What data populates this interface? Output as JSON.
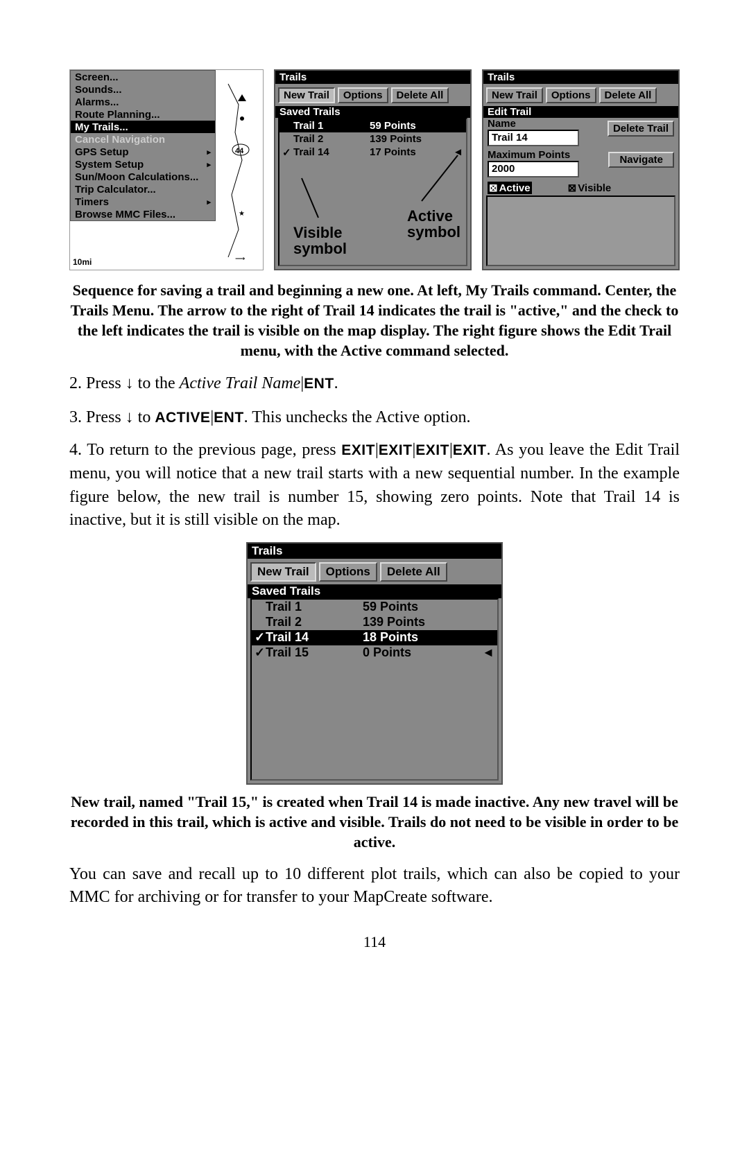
{
  "fig1": {
    "menu": {
      "items": [
        {
          "label": "Screen...",
          "sub": false
        },
        {
          "label": "Sounds...",
          "sub": false
        },
        {
          "label": "Alarms...",
          "sub": false
        },
        {
          "label": "Route Planning...",
          "sub": false
        },
        {
          "label": "My Trails...",
          "sub": false,
          "sel": true
        },
        {
          "label": "Cancel Navigation",
          "sub": false,
          "dim": true
        },
        {
          "label": "GPS Setup",
          "sub": true
        },
        {
          "label": "System Setup",
          "sub": true
        },
        {
          "label": "Sun/Moon Calculations...",
          "sub": false
        },
        {
          "label": "Trip Calculator...",
          "sub": false
        },
        {
          "label": "Timers",
          "sub": true
        },
        {
          "label": "Browse MMC Files...",
          "sub": false
        }
      ],
      "scale": "10mi",
      "map_marker": "44"
    },
    "center": {
      "title": "Trails",
      "buttons": {
        "new": "New Trail",
        "opt": "Options",
        "del": "Delete All"
      },
      "subhdr": "Saved Trails",
      "rows": [
        {
          "chk": "",
          "nm": "Trail 1",
          "pts": "59 Points",
          "arr": "",
          "sel": true
        },
        {
          "chk": "",
          "nm": "Trail 2",
          "pts": "139 Points",
          "arr": ""
        },
        {
          "chk": "✓",
          "nm": "Trail 14",
          "pts": "17 Points",
          "arr": "◄"
        }
      ],
      "callout_visible": "Visible\nsymbol",
      "callout_active": "Active\nsymbol"
    },
    "right": {
      "title": "Trails",
      "buttons": {
        "new": "New Trail",
        "opt": "Options",
        "del": "Delete All"
      },
      "subhdr": "Edit Trail",
      "name_label": "Name",
      "name_value": "Trail 14",
      "delete_btn": "Delete Trail",
      "max_label": "Maximum Points",
      "max_value": "2000",
      "nav_btn": "Navigate",
      "active": "Active",
      "visible": "Visible"
    }
  },
  "caption1": "Sequence for saving a trail and beginning a new one. At left, My Trails command. Center, the Trails Menu. The arrow to the right of Trail 14 indicates the trail is \"active,\" and the check to the left indicates the trail is visible on the map display. The right figure shows the Edit Trail menu, with the Active command selected.",
  "step2_a": "2. Press ",
  "step2_b": " to the ",
  "step2_c": "Active Trail Name",
  "step2_d": "ENT",
  "step3_a": "3. Press ",
  "step3_b": " to ",
  "step3_c": "ACTIVE",
  "step3_d": "ENT",
  "step3_e": ". This unchecks the Active option.",
  "step4_a": "4. To return to the previous page, press ",
  "step4_b": "EXIT",
  "step4_c": ". As you leave the Edit Trail menu, you will notice that a new trail starts with a new sequential number. In the example figure below, the new trail is number 15, showing zero points. Note that Trail 14 is inactive, but it is still visible on the map.",
  "fig2": {
    "title": "Trails",
    "buttons": {
      "new": "New Trail",
      "opt": "Options",
      "del": "Delete All"
    },
    "subhdr": "Saved Trails",
    "rows": [
      {
        "chk": "",
        "nm": "Trail 1",
        "pts": "59 Points",
        "arr": ""
      },
      {
        "chk": "",
        "nm": "Trail 2",
        "pts": "139 Points",
        "arr": ""
      },
      {
        "chk": "✓",
        "nm": "Trail 14",
        "pts": "18 Points",
        "arr": "",
        "sel": true
      },
      {
        "chk": "✓",
        "nm": "Trail 15",
        "pts": "0 Points",
        "arr": "◄"
      }
    ]
  },
  "caption2": "New trail, named \"Trail 15,\" is created when Trail 14 is made inactive. Any new travel will be recorded in this trail, which is active and visible. Trails do not need to be visible in order to be active.",
  "para_after": "You can save and recall up to 10 different plot trails, which can also be copied to your MMC for archiving or for transfer to your MapCreate software.",
  "page_number": "114",
  "glyph": {
    "down": "↓",
    "pipe": "|",
    "check": "✓",
    "boxx": "⊠",
    "larrow": "◄",
    "rtri": "▸"
  }
}
